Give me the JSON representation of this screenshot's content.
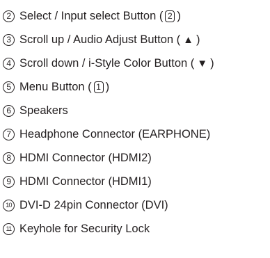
{
  "items": [
    {
      "num": "2",
      "text": "Select / Input select Button ( ",
      "key": "2",
      "end": " )"
    },
    {
      "num": "3",
      "text": "Scroll up / Audio Adjust Button ( ",
      "glyph": "▲",
      "end": " )"
    },
    {
      "num": "4",
      "text": "Scroll down / i-Style Color Button ( ",
      "glyph": "▼",
      "end": " )"
    },
    {
      "num": "5",
      "text": "Menu Button ( ",
      "key": "1",
      "end": " )"
    },
    {
      "num": "6",
      "text": "Speakers"
    },
    {
      "num": "7",
      "text": "Headphone Connector (EARPHONE)"
    },
    {
      "num": "8",
      "text": "HDMI Connector (HDMI2)"
    },
    {
      "num": "9",
      "text": "HDMI Connector (HDMI1)"
    },
    {
      "num": "10",
      "text": "DVI-D 24pin Connector (DVI)"
    },
    {
      "num": "11",
      "text": "Keyhole for Security Lock"
    }
  ]
}
